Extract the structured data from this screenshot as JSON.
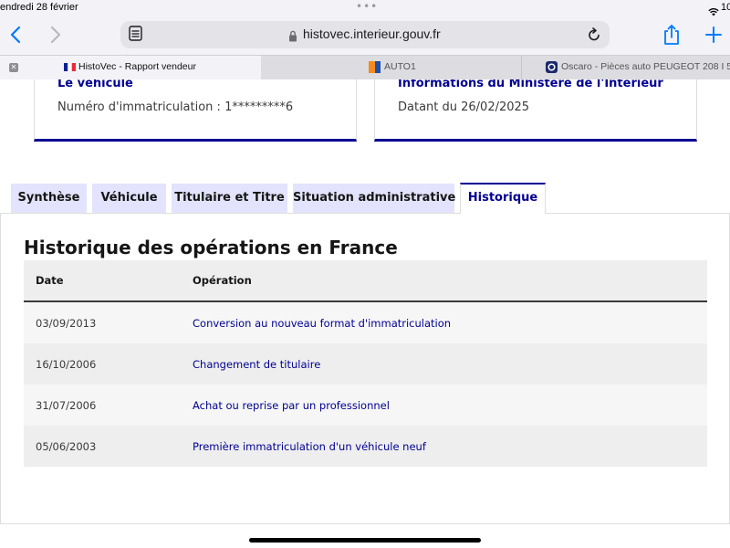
{
  "status_bar": {
    "time": "endredi 28 février",
    "battery": "10"
  },
  "browser": {
    "url": "histovec.interieur.gouv.fr",
    "tabs": [
      {
        "label": "HistoVec - Rapport vendeur",
        "active": true
      },
      {
        "label": "AUTO1",
        "active": false
      },
      {
        "label": "Oscaro - Pièces auto PEUGEOT 208 I 5",
        "active": false
      }
    ]
  },
  "cards": [
    {
      "title": "Le véhicule",
      "text": "Numéro d'immatriculation : 1*********6"
    },
    {
      "title": "Informations du Ministère de l'Intérieur",
      "text": "Datant du 26/02/2025"
    }
  ],
  "tabs": [
    {
      "label": "Synthèse",
      "active": false
    },
    {
      "label": "Véhicule",
      "active": false
    },
    {
      "label": "Titulaire et Titre",
      "active": false
    },
    {
      "label": "Situation administrative",
      "active": false
    },
    {
      "label": "Historique",
      "active": true
    }
  ],
  "history": {
    "title": "Historique des opérations en France",
    "columns": [
      "Date",
      "Opération"
    ],
    "rows": [
      {
        "date": "03/09/2013",
        "operation": "Conversion au nouveau format d'immatriculation"
      },
      {
        "date": "16/10/2006",
        "operation": "Changement de titulaire"
      },
      {
        "date": "31/07/2006",
        "operation": "Achat ou reprise par un professionnel"
      },
      {
        "date": "05/06/2003",
        "operation": "Première immatriculation d'un véhicule neuf"
      }
    ]
  },
  "colors": {
    "accent": "#000091",
    "tab_bg": "#e3e3fd"
  }
}
